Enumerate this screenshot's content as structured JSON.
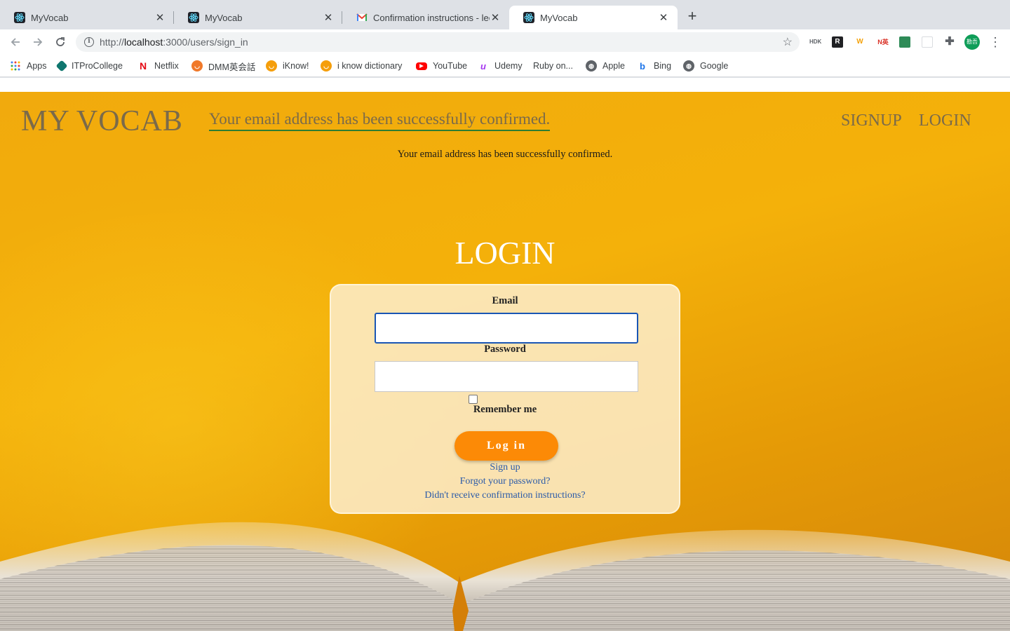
{
  "browser": {
    "tabs": [
      {
        "title": "MyVocab",
        "icon": "react-icon"
      },
      {
        "title": "MyVocab",
        "icon": "react-icon"
      },
      {
        "title": "Confirmation instructions - leo",
        "icon": "gmail-icon"
      },
      {
        "title": "MyVocab",
        "icon": "react-icon",
        "active": true
      }
    ],
    "close_glyph": "✕",
    "new_tab_glyph": "+",
    "url_prefix": "http://",
    "url_host": "localhost",
    "url_path": ":3000/users/sign_in",
    "profile_label": "勘吾",
    "bookmarks": [
      {
        "label": "Apps",
        "icon": "apps-grid-icon"
      },
      {
        "label": "ITProCollege",
        "icon": "itpro-icon"
      },
      {
        "label": "Netflix",
        "icon": "netflix-icon"
      },
      {
        "label": "DMM英会話",
        "icon": "dmm-icon"
      },
      {
        "label": "iKnow!",
        "icon": "iknow-icon"
      },
      {
        "label": "i know dictionary",
        "icon": "iknow-dictionary-icon"
      },
      {
        "label": "YouTube",
        "icon": "youtube-icon"
      },
      {
        "label": "Udemy",
        "icon": "udemy-icon"
      },
      {
        "label": "Ruby on...",
        "icon": "none"
      },
      {
        "label": "Apple",
        "icon": "globe-icon"
      },
      {
        "label": "Bing",
        "icon": "bing-icon"
      },
      {
        "label": "Google",
        "icon": "globe-icon"
      }
    ],
    "extensions": [
      "HDK",
      "R",
      "W",
      "N英"
    ]
  },
  "site": {
    "brand": "MY VOCAB",
    "flash_message": "Your email address has been successfully confirmed.",
    "nav": {
      "signup": "SIGNUP",
      "login": "LOGIN"
    },
    "notice": "Your email address has been successfully confirmed.",
    "heading": "LOGIN"
  },
  "form": {
    "email_label": "Email",
    "email_value": "",
    "password_label": "Password",
    "password_value": "",
    "remember_label": "Remember me",
    "remember_checked": false,
    "submit_label": "Log in",
    "links": {
      "signup": "Sign up",
      "forgot": "Forgot your password?",
      "confirm": "Didn't receive confirmation instructions?"
    }
  },
  "colors": {
    "brand_text": "#7a6a4a",
    "button": "#fc8a06",
    "link": "#2a5aa8",
    "focus_border": "#1a56b4"
  }
}
